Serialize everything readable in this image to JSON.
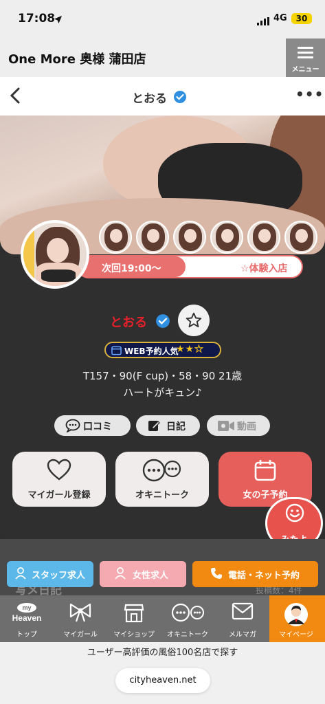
{
  "status_bar": {
    "time": "17:08",
    "network": "4G",
    "battery": "30"
  },
  "shop": {
    "name": "One More 奥様 蒲田店",
    "menu_label": "メニュー"
  },
  "nav": {
    "title": "とおる"
  },
  "profile": {
    "name": "とおる",
    "next_time": "次回19:00〜",
    "trial": "☆体験入店",
    "badge_text": "WEB予約人気",
    "badge_stars": 2,
    "badge_stars_max": 3,
    "spec": "T157・90(F cup)・58・90  21歳",
    "catchphrase": "ハートがキュン♪"
  },
  "chips": {
    "reviews": "口コミ",
    "diary": "日記",
    "video": "動画"
  },
  "actions": {
    "my_girl": "マイガール登録",
    "okini_talk": "オキニトーク",
    "reserve": "女の子予約"
  },
  "mitayo": "みたよ",
  "lower": {
    "diary_title": "写メ日記",
    "post_count": "投稿数：4件",
    "staff_recruit": "スタッフ求人",
    "female_recruit": "女性求人",
    "phone_reserve": "電話・ネット予約"
  },
  "tabs": [
    {
      "label": "トップ",
      "logo_top": "my",
      "logo_bottom": "Heaven"
    },
    {
      "label": "マイガール"
    },
    {
      "label": "マイショップ"
    },
    {
      "label": "オキニトーク"
    },
    {
      "label": "メルマガ"
    },
    {
      "label": "マイページ"
    }
  ],
  "footer": {
    "text": "ユーザー高評価の風俗100名店で探す",
    "url": "cityheaven.net"
  },
  "colors": {
    "accent": "#e8706f",
    "name_red": "#e8202a",
    "orange": "#f28a11",
    "verify_blue": "#2f8fe0"
  }
}
